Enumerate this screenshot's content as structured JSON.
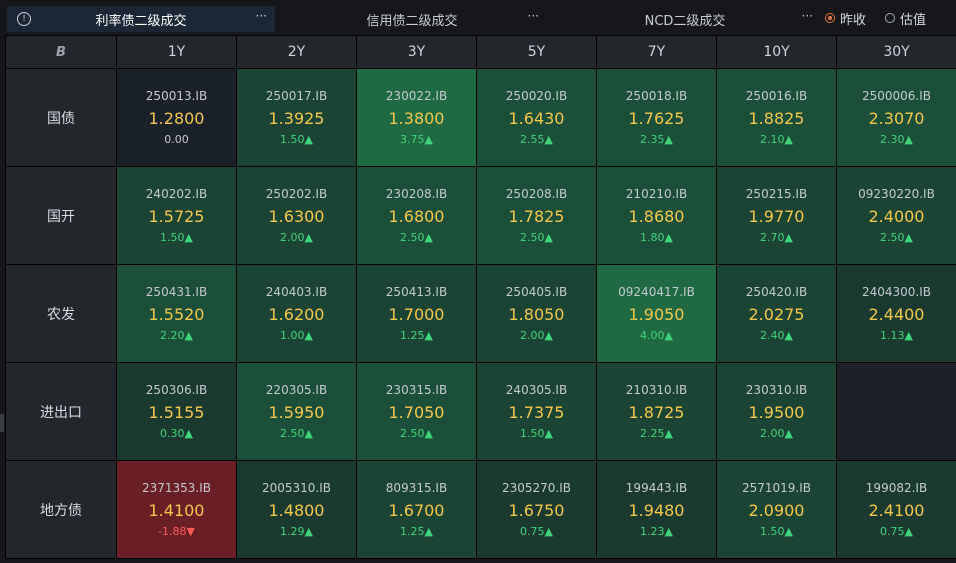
{
  "tabs": [
    {
      "label": "利率债二级成交",
      "active": true
    },
    {
      "label": "信用债二级成交",
      "active": false
    },
    {
      "label": "NCD二级成交",
      "active": false
    }
  ],
  "radios": [
    {
      "label": "昨收",
      "checked": true
    },
    {
      "label": "估值",
      "checked": false
    }
  ],
  "icons": {
    "info": "info-icon",
    "more": "more-icon",
    "corner": "b-logo-icon"
  },
  "colors": {
    "up": "#3fd37a",
    "down": "#ff5a5a",
    "rate": "#f3c74c",
    "accent": "#e6792f"
  },
  "table": {
    "corner": "B",
    "columns": [
      "1Y",
      "2Y",
      "3Y",
      "5Y",
      "7Y",
      "10Y",
      "30Y"
    ],
    "rows": [
      {
        "label": "国债",
        "cells": [
          {
            "code": "250013.IB",
            "rate": "1.2800",
            "change": "0.00"
          },
          {
            "code": "250017.IB",
            "rate": "1.3925",
            "change": "1.50▲"
          },
          {
            "code": "230022.IB",
            "rate": "1.3800",
            "change": "3.75▲"
          },
          {
            "code": "250020.IB",
            "rate": "1.6430",
            "change": "2.55▲"
          },
          {
            "code": "250018.IB",
            "rate": "1.7625",
            "change": "2.35▲"
          },
          {
            "code": "250016.IB",
            "rate": "1.8825",
            "change": "2.10▲"
          },
          {
            "code": "2500006.IB",
            "rate": "2.3070",
            "change": "2.30▲"
          }
        ]
      },
      {
        "label": "国开",
        "cells": [
          {
            "code": "240202.IB",
            "rate": "1.5725",
            "change": "1.50▲"
          },
          {
            "code": "250202.IB",
            "rate": "1.6300",
            "change": "2.00▲"
          },
          {
            "code": "230208.IB",
            "rate": "1.6800",
            "change": "2.50▲"
          },
          {
            "code": "250208.IB",
            "rate": "1.7825",
            "change": "2.50▲"
          },
          {
            "code": "210210.IB",
            "rate": "1.8680",
            "change": "1.80▲"
          },
          {
            "code": "250215.IB",
            "rate": "1.9770",
            "change": "2.70▲"
          },
          {
            "code": "09230220.IB",
            "rate": "2.4000",
            "change": "2.50▲"
          }
        ]
      },
      {
        "label": "农发",
        "cells": [
          {
            "code": "250431.IB",
            "rate": "1.5520",
            "change": "2.20▲"
          },
          {
            "code": "240403.IB",
            "rate": "1.6200",
            "change": "1.00▲"
          },
          {
            "code": "250413.IB",
            "rate": "1.7000",
            "change": "1.25▲"
          },
          {
            "code": "250405.IB",
            "rate": "1.8050",
            "change": "2.00▲"
          },
          {
            "code": "09240417.IB",
            "rate": "1.9050",
            "change": "4.00▲"
          },
          {
            "code": "250420.IB",
            "rate": "2.0275",
            "change": "2.40▲"
          },
          {
            "code": "2404300.IB",
            "rate": "2.4400",
            "change": "1.13▲"
          }
        ]
      },
      {
        "label": "进出口",
        "cells": [
          {
            "code": "250306.IB",
            "rate": "1.5155",
            "change": "0.30▲"
          },
          {
            "code": "220305.IB",
            "rate": "1.5950",
            "change": "2.50▲"
          },
          {
            "code": "230315.IB",
            "rate": "1.7050",
            "change": "2.50▲"
          },
          {
            "code": "240305.IB",
            "rate": "1.7375",
            "change": "1.50▲"
          },
          {
            "code": "210310.IB",
            "rate": "1.8725",
            "change": "2.25▲"
          },
          {
            "code": "230310.IB",
            "rate": "1.9500",
            "change": "2.00▲"
          },
          null
        ]
      },
      {
        "label": "地方债",
        "cells": [
          {
            "code": "2371353.IB",
            "rate": "1.4100",
            "change": "-1.88▼"
          },
          {
            "code": "2005310.IB",
            "rate": "1.4800",
            "change": "1.29▲"
          },
          {
            "code": "809315.IB",
            "rate": "1.6700",
            "change": "1.25▲"
          },
          {
            "code": "2305270.IB",
            "rate": "1.6750",
            "change": "0.75▲"
          },
          {
            "code": "199443.IB",
            "rate": "1.9480",
            "change": "1.23▲"
          },
          {
            "code": "2571019.IB",
            "rate": "2.0900",
            "change": "1.50▲"
          },
          {
            "code": "199082.IB",
            "rate": "2.4100",
            "change": "0.75▲"
          }
        ]
      }
    ]
  }
}
